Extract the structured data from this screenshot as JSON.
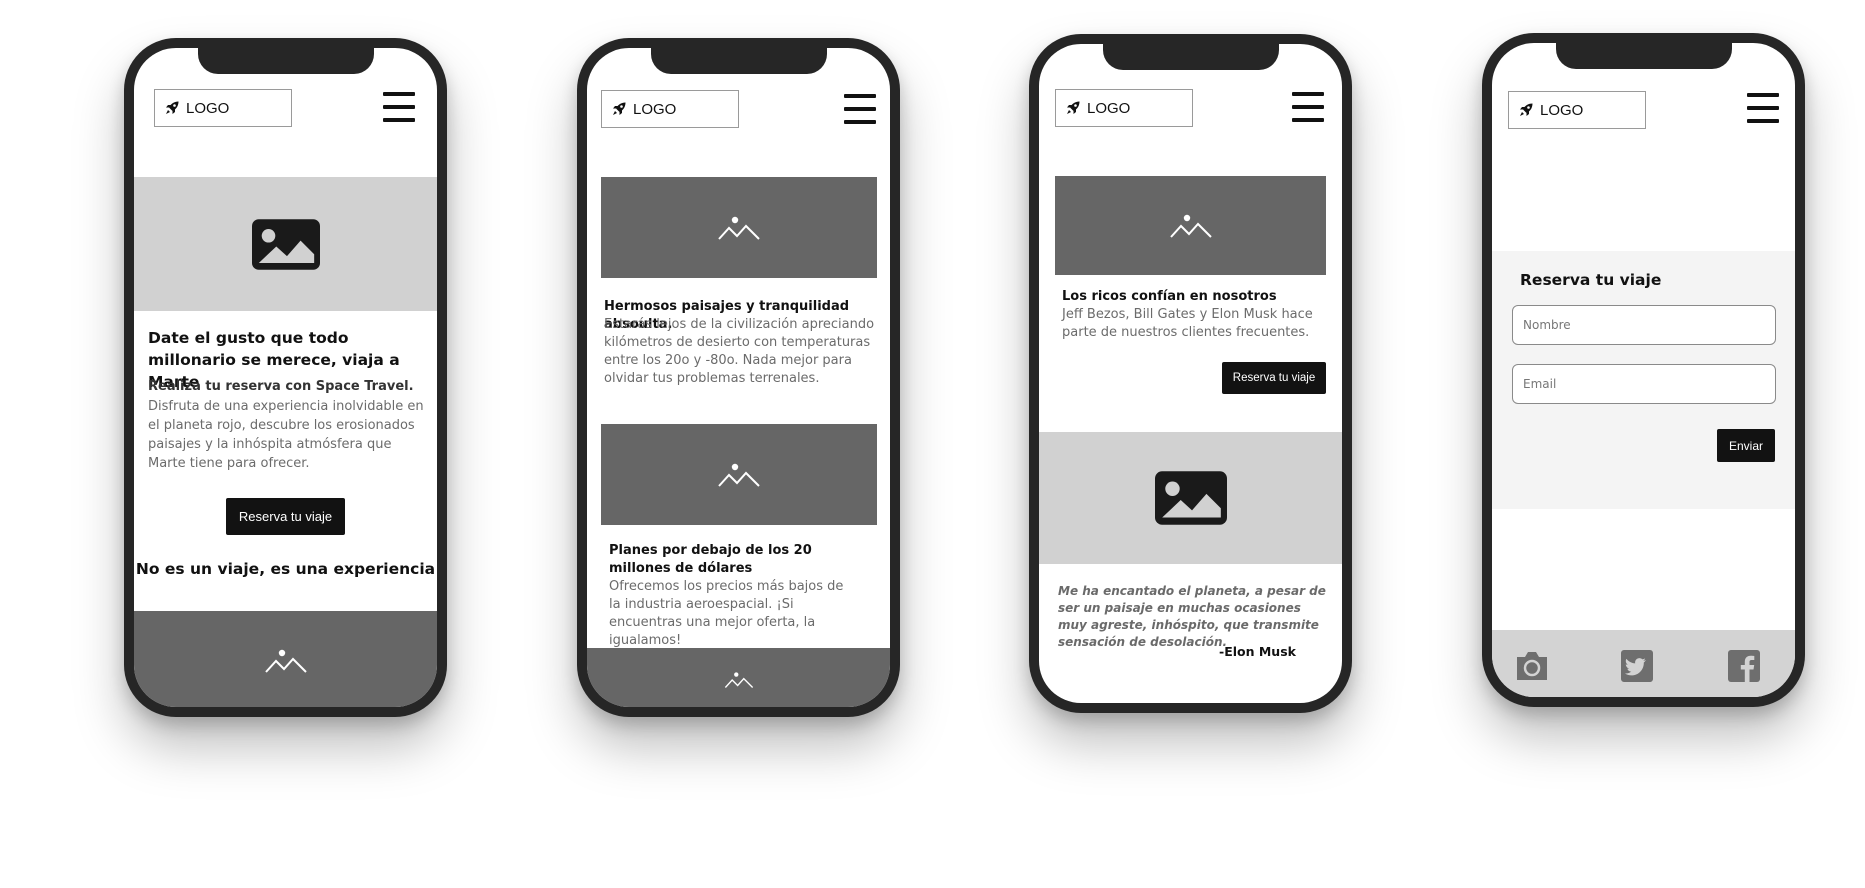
{
  "header": {
    "logo_label": "LOGO"
  },
  "screen1": {
    "headline": "Date el gusto que todo millonario se merece, viaja a Marte",
    "subhead": "Realiza tu reserva con Space Travel.",
    "body": "Disfruta de una experiencia inolvidable en el planeta rojo, descubre los erosionados paisajes y la inhóspita atmósfera que Marte tiene para ofrecer.",
    "cta": "Reserva tu viaje",
    "tagline": "No es un viaje, es una experiencia"
  },
  "screen2": {
    "features": [
      {
        "title": "Hermosos paisajes y tranquilidad absoulta.",
        "text": "Estarás lejos de la civilización apreciando kilómetros de desierto con temperaturas entre los 20o y -80o. Nada mejor para olvidar tus problemas terrenales."
      },
      {
        "title": "Planes por debajo de los 20 millones de dólares",
        "text": "Ofrecemos los precios más bajos de la industria aeroespacial. ¡Si encuentras una mejor oferta, la igualamos!"
      }
    ]
  },
  "screen3": {
    "title": "Los ricos confían en nosotros",
    "text": "Jeff Bezos, Bill Gates y Elon Musk hace parte de nuestros clientes frecuentes.",
    "cta": "Reserva tu viaje",
    "quote": "Me ha encantado el planeta, a pesar de ser un paisaje en muchas ocasiones muy agreste, inhóspito, que transmite sensación de desolación.",
    "author": "-Elon Musk"
  },
  "screen4": {
    "form_title": "Reserva tu viaje",
    "name_placeholder": "Nombre",
    "email_placeholder": "Email",
    "submit": "Enviar",
    "social_icons": [
      "camera-icon",
      "twitter-icon",
      "facebook-icon"
    ]
  },
  "colors": {
    "dark": "#121212",
    "placeholder_light": "#d1d1d1",
    "placeholder_dark": "#666666",
    "frame": "#262626"
  }
}
